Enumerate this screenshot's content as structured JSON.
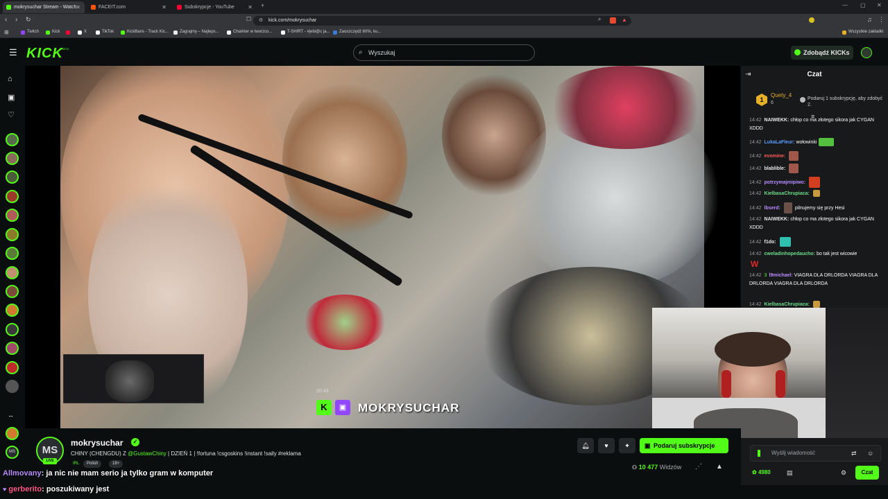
{
  "browser": {
    "tabs": [
      {
        "label": "mokrysuchar Stream - Watch",
        "color": "#53fc18"
      },
      {
        "label": "FACEIT.com",
        "color": "#ff5500"
      },
      {
        "label": "Subskrypcje - YouTube",
        "color": "#ff0033"
      }
    ],
    "url": "kick.com/mokrysuchar",
    "bookmarks": [
      {
        "label": "Twitch",
        "color": "#9146ff"
      },
      {
        "label": "Kick",
        "color": "#53fc18"
      },
      {
        "label": "",
        "color": "#ff0033"
      },
      {
        "label": "X",
        "color": "#ffffff"
      },
      {
        "label": "TikTok",
        "color": "#ffffff"
      },
      {
        "label": "KickBans - Track Kic...",
        "color": "#53fc18"
      },
      {
        "label": "Zagrajmy – Najleps...",
        "color": "#e8e8e8"
      },
      {
        "label": "Charkter w tworzco...",
        "color": "#ffffff"
      },
      {
        "label": "T-SHIRT - #jebi@c ja...",
        "color": "#ffffff"
      },
      {
        "label": "Zaoszczędź 60%, ku...",
        "color": "#3b7bd8"
      }
    ],
    "all_bookmarks": "Wszystkie zakładki"
  },
  "header": {
    "logo": "KICK",
    "logo_sup": "BETA",
    "search_placeholder": "Wyszukaj",
    "get_kicks": "Zdobądź KICKs"
  },
  "player": {
    "watermark_name": "MOKRYSUCHAR",
    "watermark_time": "20:43"
  },
  "chat": {
    "title": "Czat",
    "sub_user": "Quety_4",
    "sub_count": "6",
    "sub_badge": "1",
    "sub_text": "Podaruj 1 subskrypcję, aby zdobyć 2.",
    "messages": [
      {
        "time": "14:42",
        "user": "NAIWEKK:",
        "color": "#e8e8e8",
        "text": "chłop co ma złotego sikora jak CYGAN XDDD"
      },
      {
        "time": "14:42",
        "user": "LukaLaFleur:",
        "color": "#5b9bff",
        "text": "wołowinki"
      },
      {
        "time": "14:42",
        "user": "evomine:",
        "color": "#ff5a5a",
        "text": ""
      },
      {
        "time": "14:42",
        "user": "blablible:",
        "color": "#e8e8e8",
        "text": ""
      },
      {
        "time": "14:42",
        "user": "potrzymajmipiwo:",
        "color": "#b98cff",
        "text": ""
      },
      {
        "time": "14:42",
        "user": "KielbasaChrupiaca:",
        "color": "#6bdc8a",
        "text": ""
      },
      {
        "time": "14:42",
        "user": "lbserd:",
        "color": "#b98cff",
        "text": "pilnujemy się przy Hesi"
      },
      {
        "time": "14:42",
        "user": "NAIWEKK:",
        "color": "#e8e8e8",
        "text": "chłop co ma złotego sikora jak CYGAN XDDD"
      },
      {
        "time": "14:42",
        "user": "f1do:",
        "color": "#e8e8e8",
        "text": ""
      },
      {
        "time": "14:42",
        "user": "cweladinhopedaucho:",
        "color": "#6bdc8a",
        "text": "bo tak jest wicowie"
      },
      {
        "time": "14:42",
        "user": "l9michael:",
        "color": "#b98cff",
        "text": "VIAGRA DLA DRLORDA VIAGRA DLA DRLORDA VIAGRA DLA DRLORDA"
      },
      {
        "time": "14:42",
        "user": "KielbasaChrupiaca:",
        "color": "#6bdc8a",
        "text": ""
      }
    ],
    "input_placeholder": "Wyślij wiadomość",
    "points": "4980",
    "send_label": "Czat",
    "badge_num": "3"
  },
  "stream": {
    "streamer": "mokrysuchar",
    "avatar": "MS",
    "live": "LIVE",
    "title_prefix": "CHINY (CHENGDU) Z",
    "title_mention": "@GustawChiny",
    "title_suffix": "| DZIEŃ 1 | !fortuna !csgoskins !instant !saily #reklama",
    "tag_irl": "IRL",
    "tag_lang": "Polish",
    "tag_age": "18+",
    "gift_sub": "Podaruj subskrypcje",
    "viewers": "10 477",
    "viewers_label": "Widzów"
  },
  "overlay_chat": [
    {
      "user": "Allmovany",
      "text": ": ja nic nie mam serio ja tylko gram w komputer",
      "color": "#b98cff"
    },
    {
      "user": "gerberito",
      "text": ": poszukiwany jest",
      "color": "#ff5a8a"
    }
  ],
  "colors": {
    "accent": "#53fc18",
    "bg": "#0b0e0f",
    "chat_bg": "#18191b"
  }
}
